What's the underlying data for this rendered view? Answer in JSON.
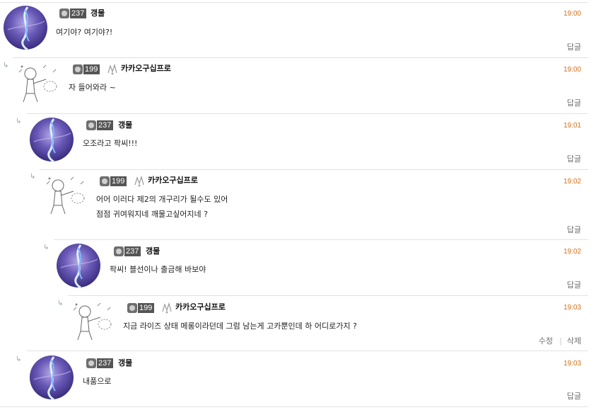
{
  "labels": {
    "reply": "답글",
    "edit": "수정",
    "delete": "삭제",
    "separator": "|",
    "reply_arrow": "↳"
  },
  "comments": [
    {
      "user": "갱물",
      "level": "237",
      "time": "19:00",
      "lines": [
        "여기야? 여기야?!"
      ]
    },
    {
      "user": "카카오구십프로",
      "level": "199",
      "time": "19:00",
      "lines": [
        "자 들어와라 ~"
      ]
    },
    {
      "user": "갱물",
      "level": "237",
      "time": "19:01",
      "lines": [
        "오조라고 팍씨!!!"
      ]
    },
    {
      "user": "카카오구십프로",
      "level": "199",
      "time": "19:02",
      "lines": [
        "어어 이러다 제2의 개구리가 될수도 있어",
        "점점 귀여워지네 깨물고싶어지네 ?"
      ]
    },
    {
      "user": "갱물",
      "level": "237",
      "time": "19:02",
      "lines": [
        "팍씨! 블선이나 출금해 바보야"
      ]
    },
    {
      "user": "카카오구십프로",
      "level": "199",
      "time": "19:03",
      "lines": [
        "지금 라이즈 상태 메롱이라던데 그럼 남는게 고카뿐인데 하 어디로가지 ?"
      ]
    },
    {
      "user": "갱물",
      "level": "237",
      "time": "19:03",
      "lines": [
        "내품으로"
      ]
    }
  ]
}
